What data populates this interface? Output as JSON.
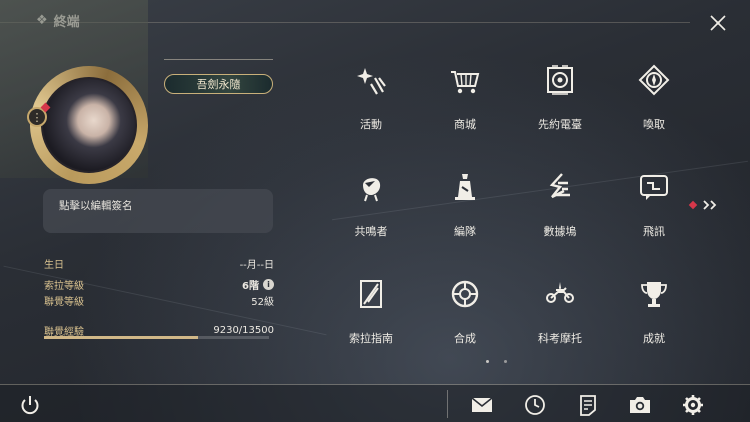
{
  "header": {
    "title": "終端",
    "glyph": "❖"
  },
  "profile": {
    "name": "吾劍永隨",
    "signature": "點擊以編輯簽名"
  },
  "stats": {
    "birthday_label": "生日",
    "birthday_value": "--月--日",
    "sola_level_label": "索拉等級",
    "sola_level_value": "6階",
    "union_level_label": "聯覺等級",
    "union_level_value": "52級",
    "union_exp_label": "聯覺經驗",
    "union_exp_value": "9230/13500",
    "union_exp_fraction": 0.684
  },
  "grid": [
    {
      "label": "活動",
      "icon": "sparkle-icon"
    },
    {
      "label": "商城",
      "icon": "cart-icon"
    },
    {
      "label": "先約電臺",
      "icon": "radio-icon"
    },
    {
      "label": "喚取",
      "icon": "compass-icon"
    },
    {
      "label": "共鳴者",
      "icon": "resonator-icon"
    },
    {
      "label": "編隊",
      "icon": "chess-icon"
    },
    {
      "label": "數據塢",
      "icon": "data-dock-icon"
    },
    {
      "label": "飛訊",
      "icon": "chat-icon"
    },
    {
      "label": "索拉指南",
      "icon": "guide-book-icon"
    },
    {
      "label": "合成",
      "icon": "synthesis-icon"
    },
    {
      "label": "科考摩托",
      "icon": "motorbike-icon"
    },
    {
      "label": "成就",
      "icon": "trophy-icon"
    }
  ],
  "colors": {
    "accent_gold": "#d8c18f",
    "badge_red": "#d6374a"
  }
}
